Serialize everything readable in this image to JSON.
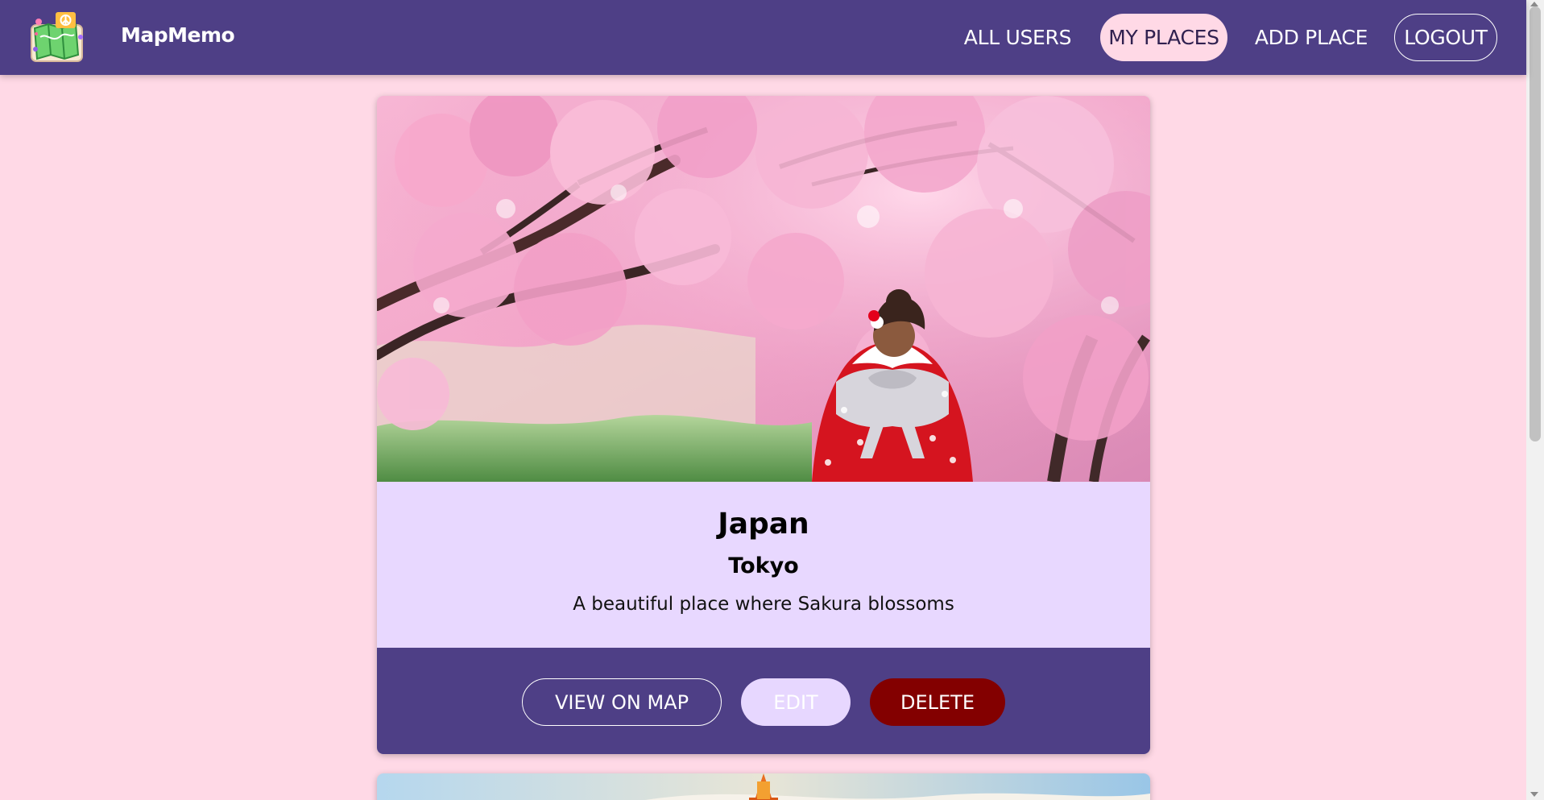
{
  "app": {
    "brand": "MapMemo",
    "logo_icon": "map-memo-logo"
  },
  "nav": {
    "all_users": "ALL USERS",
    "my_places": "MY PLACES",
    "add_place": "ADD PLACE",
    "logout": "LOGOUT"
  },
  "place": {
    "title": "Japan",
    "address": "Tokyo",
    "description": "A beautiful place where Sakura blossoms",
    "image_icon": "sakura-kimono-photo"
  },
  "actions": {
    "view_on_map": "VIEW ON MAP",
    "edit": "EDIT",
    "delete": "DELETE"
  },
  "next_place": {
    "image_icon": "tower-skyline-photo"
  },
  "colors": {
    "background": "#ffd9e6",
    "header": "#4e3f86",
    "card_info": "#e8d8ff",
    "active_nav": "#ffd9e6",
    "delete": "#830000"
  }
}
